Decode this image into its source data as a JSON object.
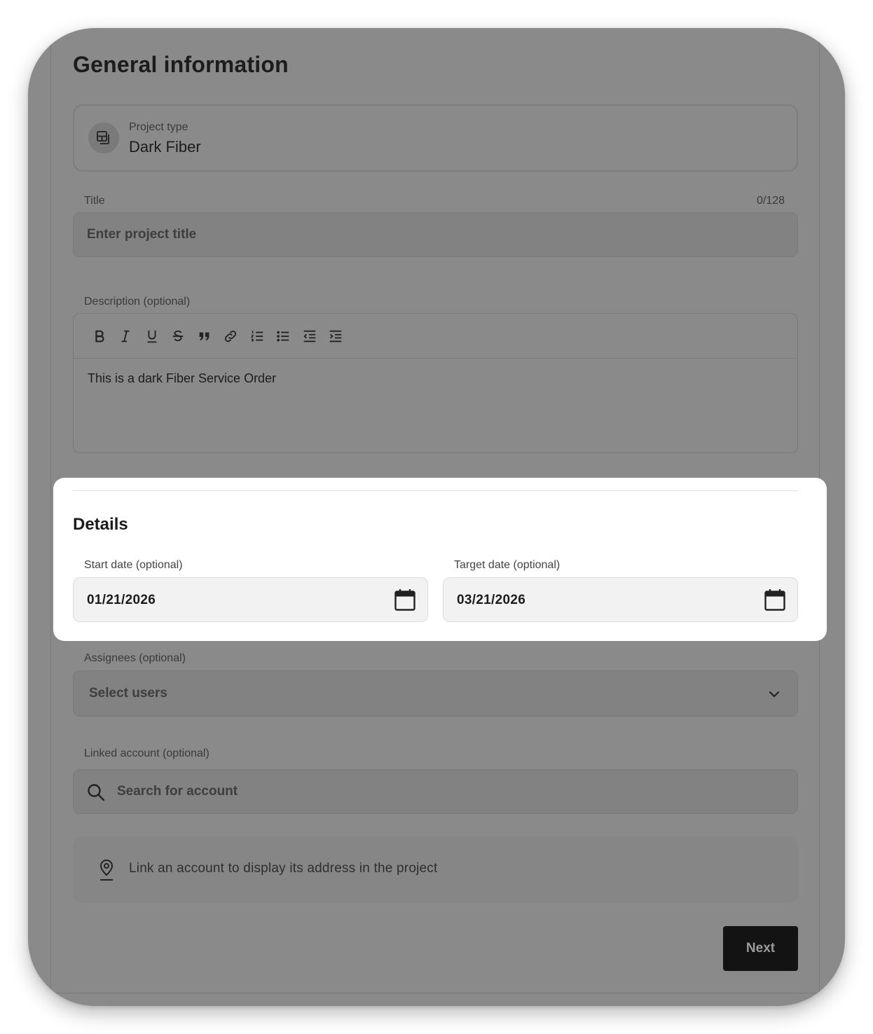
{
  "header": {
    "title": "General information"
  },
  "project_type": {
    "label": "Project type",
    "value": "Dark Fiber",
    "icon": "project-type-icon"
  },
  "title_field": {
    "label": "Title",
    "counter": "0/128",
    "placeholder": "Enter project title"
  },
  "description": {
    "label": "Description (optional)",
    "toolbar": [
      "bold-icon",
      "italic-icon",
      "underline-icon",
      "strikethrough-icon",
      "quote-icon",
      "link-icon",
      "ordered-list-icon",
      "bullet-list-icon",
      "outdent-icon",
      "indent-icon"
    ],
    "text": "This is a dark Fiber Service Order"
  },
  "details": {
    "title": "Details",
    "start_date": {
      "label": "Start date (optional)",
      "value": "01/21/2026"
    },
    "target_date": {
      "label": "Target date (optional)",
      "value": "03/21/2026"
    }
  },
  "assignees": {
    "label": "Assignees (optional)",
    "placeholder": "Select users"
  },
  "linked_account": {
    "label": "Linked account (optional)",
    "placeholder": "Search for account"
  },
  "info": {
    "text": "Link an account to display its address in the project"
  },
  "footer": {
    "next_label": "Next"
  },
  "colors": {
    "overlay": "#8a8a8a",
    "highlight": "#ffffff",
    "button": "#131313"
  }
}
